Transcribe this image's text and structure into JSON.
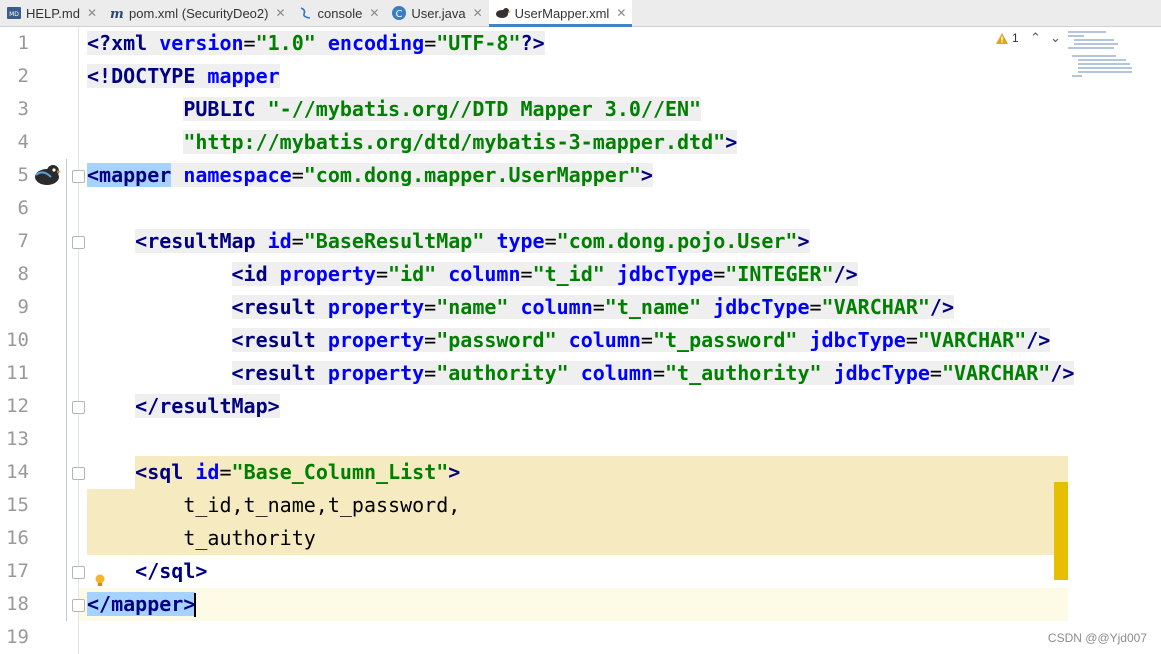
{
  "tabs": [
    {
      "label": "HELP.md",
      "icon": "markdown-file-icon",
      "active": false
    },
    {
      "label": "pom.xml (SecurityDeo2)",
      "icon": "maven-file-icon",
      "active": false
    },
    {
      "label": "console",
      "icon": "console-icon",
      "active": false
    },
    {
      "label": "User.java",
      "icon": "java-class-icon",
      "active": false
    },
    {
      "label": "UserMapper.xml",
      "icon": "mybatis-xml-icon",
      "active": true
    }
  ],
  "inspection": {
    "warning_count": "1"
  },
  "line_numbers": [
    "1",
    "2",
    "3",
    "4",
    "5",
    "6",
    "7",
    "8",
    "9",
    "10",
    "11",
    "12",
    "13",
    "14",
    "15",
    "16",
    "17",
    "18",
    "19"
  ],
  "code_lines": [
    [
      [
        "pi",
        "<?xml "
      ],
      [
        "attr",
        "version"
      ],
      [
        "punc",
        "="
      ],
      [
        "val",
        "\"1.0\""
      ],
      [
        "punc",
        " "
      ],
      [
        "attr",
        "encoding"
      ],
      [
        "punc",
        "="
      ],
      [
        "val",
        "\"UTF-8\""
      ],
      [
        "pi",
        "?>"
      ]
    ],
    [
      [
        "tag",
        "<!DOCTYPE "
      ],
      [
        "attr",
        "mapper"
      ]
    ],
    [
      [
        "text",
        "        "
      ],
      [
        "tag",
        "PUBLIC "
      ],
      [
        "val",
        "\"-//mybatis.org//DTD Mapper 3.0//EN\""
      ]
    ],
    [
      [
        "text",
        "        "
      ],
      [
        "val",
        "\"http://mybatis.org/dtd/mybatis-3-mapper.dtd\""
      ],
      [
        "tag",
        ">"
      ]
    ],
    [
      [
        "tag",
        "<mapper"
      ],
      [
        "punc",
        " "
      ],
      [
        "attr",
        "namespace"
      ],
      [
        "punc",
        "="
      ],
      [
        "val",
        "\"com.dong.mapper.UserMapper\""
      ],
      [
        "tag",
        ">"
      ]
    ],
    [],
    [
      [
        "text",
        "    "
      ],
      [
        "tag",
        "<resultMap "
      ],
      [
        "attr",
        "id"
      ],
      [
        "punc",
        "="
      ],
      [
        "val",
        "\"BaseResultMap\""
      ],
      [
        "punc",
        " "
      ],
      [
        "attr",
        "type"
      ],
      [
        "punc",
        "="
      ],
      [
        "val",
        "\"com.dong.pojo.User\""
      ],
      [
        "tag",
        ">"
      ]
    ],
    [
      [
        "text",
        "            "
      ],
      [
        "tag",
        "<id "
      ],
      [
        "attr",
        "property"
      ],
      [
        "punc",
        "="
      ],
      [
        "val",
        "\"id\""
      ],
      [
        "punc",
        " "
      ],
      [
        "attr",
        "column"
      ],
      [
        "punc",
        "="
      ],
      [
        "val",
        "\"t_id\""
      ],
      [
        "punc",
        " "
      ],
      [
        "attr",
        "jdbcType"
      ],
      [
        "punc",
        "="
      ],
      [
        "val",
        "\"INTEGER\""
      ],
      [
        "tag",
        "/>"
      ]
    ],
    [
      [
        "text",
        "            "
      ],
      [
        "tag",
        "<result "
      ],
      [
        "attr",
        "property"
      ],
      [
        "punc",
        "="
      ],
      [
        "val",
        "\"name\""
      ],
      [
        "punc",
        " "
      ],
      [
        "attr",
        "column"
      ],
      [
        "punc",
        "="
      ],
      [
        "val",
        "\"t_name\""
      ],
      [
        "punc",
        " "
      ],
      [
        "attr",
        "jdbcType"
      ],
      [
        "punc",
        "="
      ],
      [
        "val",
        "\"VARCHAR\""
      ],
      [
        "tag",
        "/>"
      ]
    ],
    [
      [
        "text",
        "            "
      ],
      [
        "tag",
        "<result "
      ],
      [
        "attr",
        "property"
      ],
      [
        "punc",
        "="
      ],
      [
        "val",
        "\"password\""
      ],
      [
        "punc",
        " "
      ],
      [
        "attr",
        "column"
      ],
      [
        "punc",
        "="
      ],
      [
        "val",
        "\"t_password\""
      ],
      [
        "punc",
        " "
      ],
      [
        "attr",
        "jdbcType"
      ],
      [
        "punc",
        "="
      ],
      [
        "val",
        "\"VARCHAR\""
      ],
      [
        "tag",
        "/>"
      ]
    ],
    [
      [
        "text",
        "            "
      ],
      [
        "tag",
        "<result "
      ],
      [
        "attr",
        "property"
      ],
      [
        "punc",
        "="
      ],
      [
        "val",
        "\"authority\""
      ],
      [
        "punc",
        " "
      ],
      [
        "attr",
        "column"
      ],
      [
        "punc",
        "="
      ],
      [
        "val",
        "\"t_authority\""
      ],
      [
        "punc",
        " "
      ],
      [
        "attr",
        "jdbcType"
      ],
      [
        "punc",
        "="
      ],
      [
        "val",
        "\"VARCHAR\""
      ],
      [
        "tag",
        "/>"
      ]
    ],
    [
      [
        "text",
        "    "
      ],
      [
        "tag",
        "</resultMap>"
      ]
    ],
    [],
    [
      [
        "text",
        "    "
      ],
      [
        "tag",
        "<sql "
      ],
      [
        "attr",
        "id"
      ],
      [
        "punc",
        "="
      ],
      [
        "val",
        "\"Base_Column_List\""
      ],
      [
        "tag",
        ">"
      ]
    ],
    [
      [
        "text",
        "        t_id,t_name,t_password,"
      ]
    ],
    [
      [
        "text",
        "        t_authority"
      ]
    ],
    [
      [
        "text",
        "    "
      ],
      [
        "tag",
        "</sql>"
      ]
    ],
    [
      [
        "tag",
        "</mapper>"
      ]
    ],
    []
  ],
  "watermark": "CSDN @@Yjd007",
  "colors": {
    "tag": "#000080",
    "attr": "#0000ff",
    "value": "#008000",
    "selection": "#a6d2ff",
    "injected_bg": "#f5eac0",
    "accent_tab": "#4083c9"
  }
}
